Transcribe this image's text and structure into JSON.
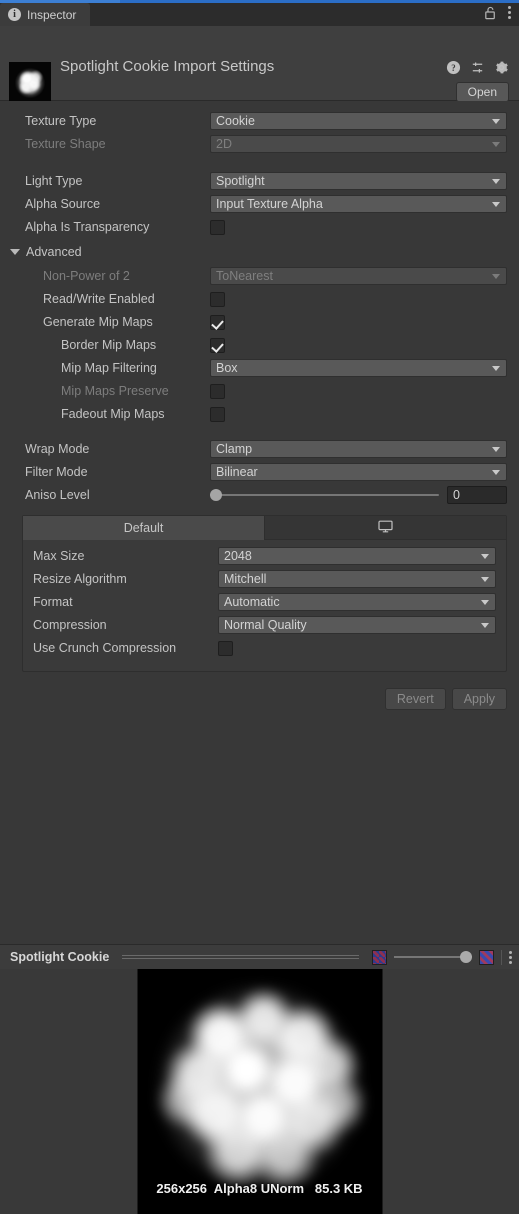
{
  "window": {
    "tab_label": "Inspector",
    "info_icon": "info-icon",
    "lock_icon": "unlocked-padlock-icon",
    "menu_icon": "kebab-menu-icon"
  },
  "object_header": {
    "title": "Spotlight Cookie Import Settings",
    "thumbnail_name": "texture-thumbnail",
    "help_icon": "help-icon",
    "preset_icon": "preset-icon",
    "settings_icon": "gear-icon",
    "open_label": "Open"
  },
  "properties": {
    "texture_type": {
      "label": "Texture Type",
      "value": "Cookie",
      "disabled": false
    },
    "texture_shape": {
      "label": "Texture Shape",
      "value": "2D",
      "disabled": true
    },
    "light_type": {
      "label": "Light Type",
      "value": "Spotlight",
      "disabled": false
    },
    "alpha_source": {
      "label": "Alpha Source",
      "value": "Input Texture Alpha",
      "disabled": false
    },
    "alpha_is_transparency": {
      "label": "Alpha Is Transparency",
      "checked": false
    }
  },
  "advanced": {
    "label": "Advanced",
    "expanded": true,
    "non_power_of_2": {
      "label": "Non-Power of 2",
      "value": "ToNearest",
      "disabled": true
    },
    "read_write_enabled": {
      "label": "Read/Write Enabled",
      "checked": false
    },
    "generate_mip_maps": {
      "label": "Generate Mip Maps",
      "checked": true
    },
    "border_mip_maps": {
      "label": "Border Mip Maps",
      "checked": true
    },
    "mip_map_filtering": {
      "label": "Mip Map Filtering",
      "value": "Box"
    },
    "mip_maps_preserve": {
      "label": "Mip Maps Preserve ",
      "checked": false
    },
    "fadeout_mip_maps": {
      "label": "Fadeout Mip Maps",
      "checked": false
    }
  },
  "sampling": {
    "wrap_mode": {
      "label": "Wrap Mode",
      "value": "Clamp"
    },
    "filter_mode": {
      "label": "Filter Mode",
      "value": "Bilinear"
    },
    "aniso_level": {
      "label": "Aniso Level",
      "value": "0",
      "min": 0,
      "max": 16
    }
  },
  "platform": {
    "tabs": [
      {
        "label": "Default",
        "selected": true,
        "icon": ""
      },
      {
        "label": "",
        "selected": false,
        "icon": "monitor-icon"
      }
    ],
    "max_size": {
      "label": "Max Size",
      "value": "2048"
    },
    "resize_algorithm": {
      "label": "Resize Algorithm",
      "value": "Mitchell"
    },
    "format": {
      "label": "Format",
      "value": "Automatic"
    },
    "compression": {
      "label": "Compression",
      "value": "Normal Quality"
    },
    "use_crunch_compression": {
      "label": "Use Crunch Compression",
      "checked": false
    }
  },
  "actions": {
    "revert_label": "Revert",
    "apply_label": "Apply",
    "disabled": true
  },
  "preview": {
    "title": "Spotlight Cookie",
    "mip_icon_left": "checker-small-icon",
    "mip_icon_right": "checker-large-icon",
    "menu_icon": "kebab-menu-icon",
    "meta": "256x256  Alpha8 UNorm   85.3 KB"
  },
  "colors": {
    "window_bg": "#383838",
    "header_bg": "#3f3f3f",
    "tab_bg": "#2c2c2c",
    "accent": "#3c7fd4",
    "field_bg": "#595959",
    "text": "#c4c4c4",
    "text_dim": "#7d7d7d"
  }
}
